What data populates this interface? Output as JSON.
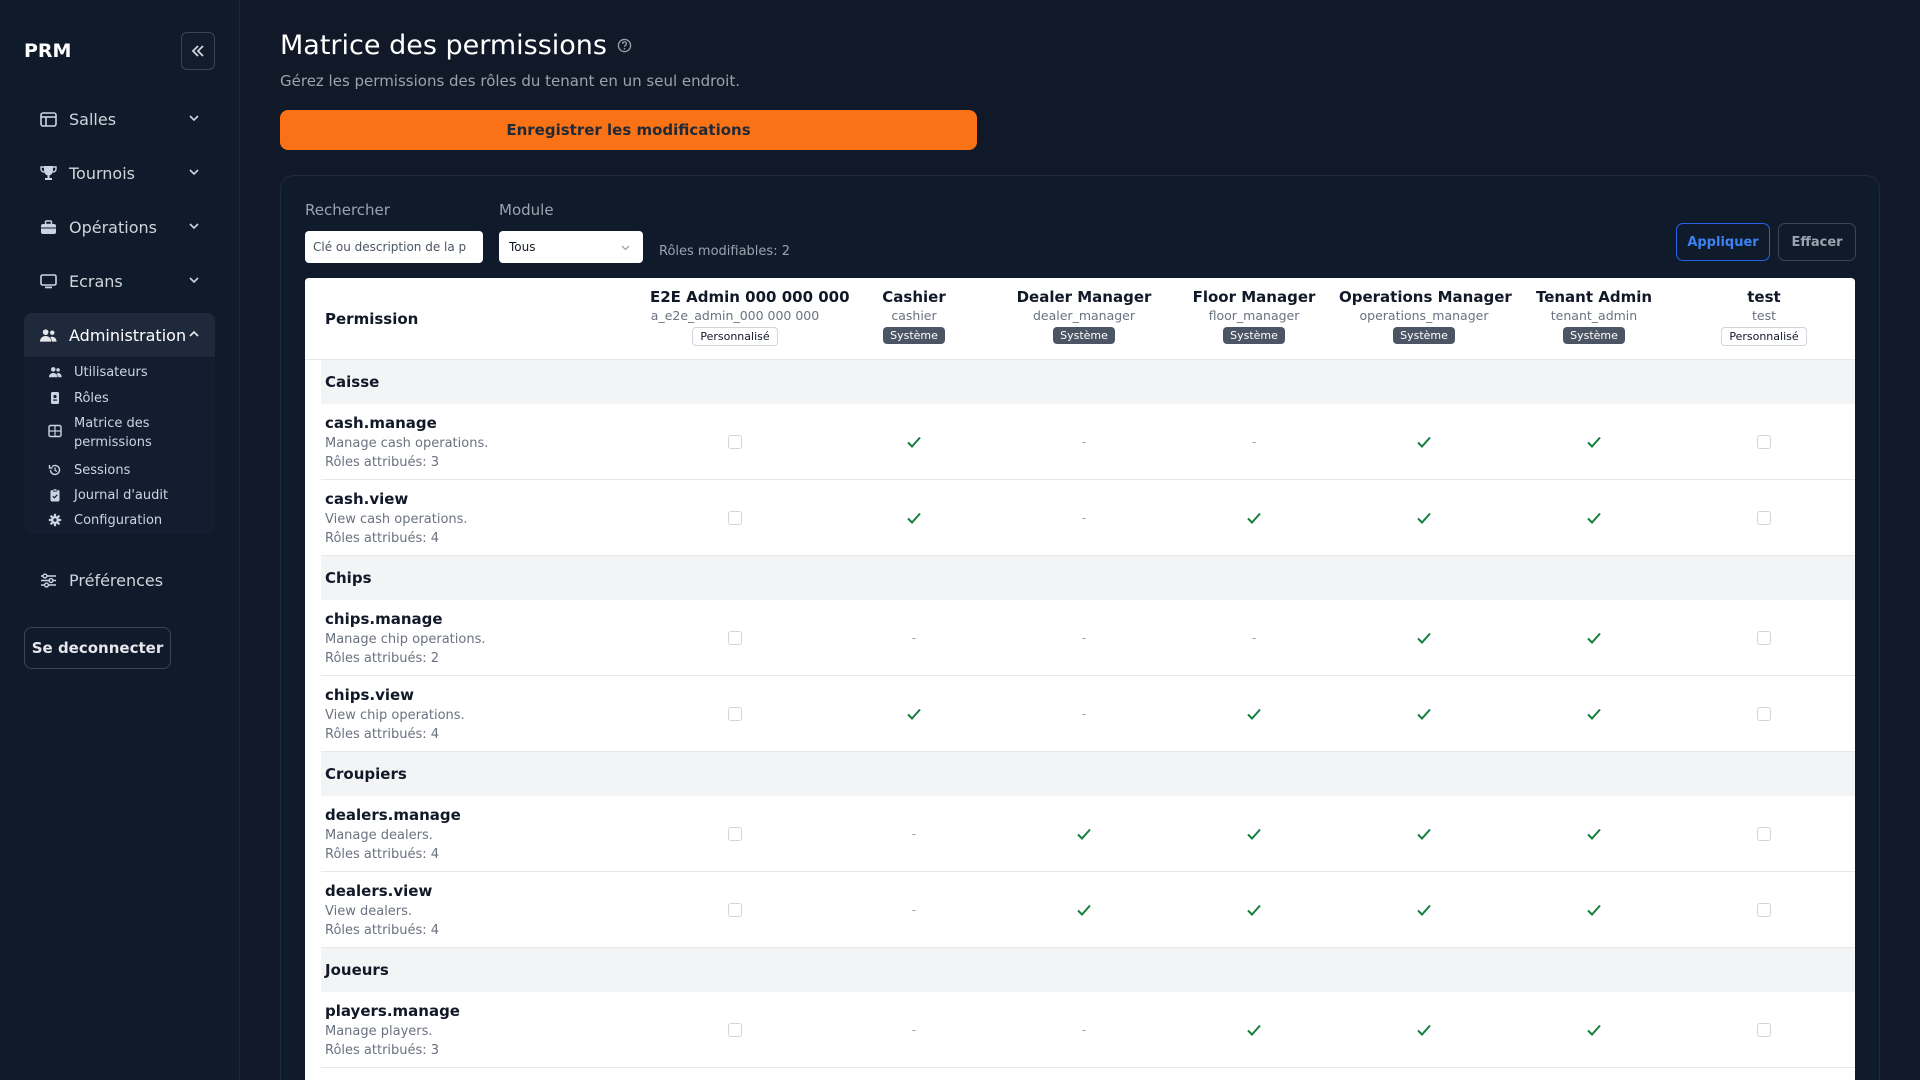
{
  "sidebar": {
    "brand": "PRM",
    "items": [
      {
        "label": "Salles"
      },
      {
        "label": "Tournois"
      },
      {
        "label": "Opérations"
      },
      {
        "label": "Ecrans"
      },
      {
        "label": "Administration"
      },
      {
        "label": "Préférences"
      }
    ],
    "admin_sub": [
      {
        "label": "Utilisateurs"
      },
      {
        "label": "Rôles"
      },
      {
        "label": "Matrice des permissions"
      },
      {
        "label": "Sessions"
      },
      {
        "label": "Journal d'audit"
      },
      {
        "label": "Configuration"
      }
    ],
    "logout_label": "Se deconnecter"
  },
  "header": {
    "title": "Matrice des permissions",
    "subtitle": "Gérez les permissions des rôles du tenant en un seul endroit.",
    "save_label": "Enregistrer les modifications"
  },
  "filters": {
    "search_label": "Rechercher",
    "search_placeholder": "Clé ou description de la p",
    "module_label": "Module",
    "module_value": "Tous",
    "roles_modifiable": "Rôles modifiables: 2",
    "apply_label": "Appliquer",
    "clear_label": "Effacer"
  },
  "table": {
    "permission_header": "Permission",
    "roles": [
      {
        "name": "E2E Admin 000 000 000",
        "key": "a_e2e_admin_000 000 000",
        "badge": "Personnalisé",
        "type": "custom"
      },
      {
        "name": "Cashier",
        "key": "cashier",
        "badge": "Système",
        "type": "system"
      },
      {
        "name": "Dealer Manager",
        "key": "dealer_manager",
        "badge": "Système",
        "type": "system"
      },
      {
        "name": "Floor Manager",
        "key": "floor_manager",
        "badge": "Système",
        "type": "system"
      },
      {
        "name": "Operations Manager",
        "key": "operations_manager",
        "badge": "Système",
        "type": "system"
      },
      {
        "name": "Tenant Admin",
        "key": "tenant_admin",
        "badge": "Système",
        "type": "system"
      },
      {
        "name": "test",
        "key": "test",
        "badge": "Personnalisé",
        "type": "custom"
      }
    ],
    "groups": [
      {
        "name": "Caisse",
        "permissions": [
          {
            "key": "cash.manage",
            "desc": "Manage cash operations.",
            "count": "Rôles attribués: 3",
            "cells": [
              "box",
              "check",
              "dash",
              "dash",
              "check",
              "check",
              "box"
            ]
          },
          {
            "key": "cash.view",
            "desc": "View cash operations.",
            "count": "Rôles attribués: 4",
            "cells": [
              "box",
              "check",
              "dash",
              "check",
              "check",
              "check",
              "box"
            ]
          }
        ]
      },
      {
        "name": "Chips",
        "permissions": [
          {
            "key": "chips.manage",
            "desc": "Manage chip operations.",
            "count": "Rôles attribués: 2",
            "cells": [
              "box",
              "dash",
              "dash",
              "dash",
              "check",
              "check",
              "box"
            ]
          },
          {
            "key": "chips.view",
            "desc": "View chip operations.",
            "count": "Rôles attribués: 4",
            "cells": [
              "box",
              "check",
              "dash",
              "check",
              "check",
              "check",
              "box"
            ]
          }
        ]
      },
      {
        "name": "Croupiers",
        "permissions": [
          {
            "key": "dealers.manage",
            "desc": "Manage dealers.",
            "count": "Rôles attribués: 4",
            "cells": [
              "box",
              "dash",
              "check",
              "check",
              "check",
              "check",
              "box"
            ]
          },
          {
            "key": "dealers.view",
            "desc": "View dealers.",
            "count": "Rôles attribués: 4",
            "cells": [
              "box",
              "dash",
              "check",
              "check",
              "check",
              "check",
              "box"
            ]
          }
        ]
      },
      {
        "name": "Joueurs",
        "permissions": [
          {
            "key": "players.manage",
            "desc": "Manage players.",
            "count": "Rôles attribués: 3",
            "cells": [
              "box",
              "dash",
              "dash",
              "check",
              "check",
              "check",
              "box"
            ]
          }
        ]
      }
    ]
  },
  "colors": {
    "accent": "#f97316",
    "check": "#15803d",
    "apply": "#2563eb"
  }
}
